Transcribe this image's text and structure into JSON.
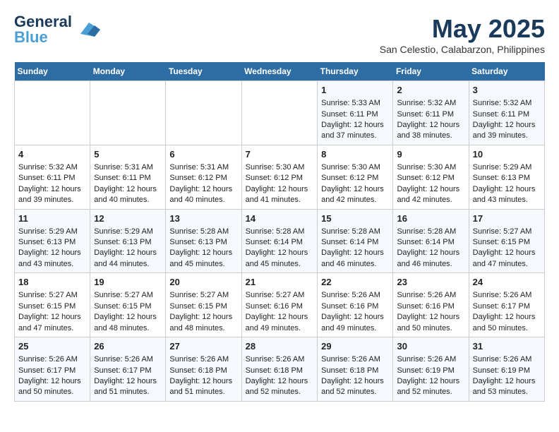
{
  "header": {
    "logo_line1": "General",
    "logo_line2": "Blue",
    "month_year": "May 2025",
    "location": "San Celestio, Calabarzon, Philippines"
  },
  "days_of_week": [
    "Sunday",
    "Monday",
    "Tuesday",
    "Wednesday",
    "Thursday",
    "Friday",
    "Saturday"
  ],
  "weeks": [
    [
      {
        "day": "",
        "sunrise": "",
        "sunset": "",
        "daylight": ""
      },
      {
        "day": "",
        "sunrise": "",
        "sunset": "",
        "daylight": ""
      },
      {
        "day": "",
        "sunrise": "",
        "sunset": "",
        "daylight": ""
      },
      {
        "day": "",
        "sunrise": "",
        "sunset": "",
        "daylight": ""
      },
      {
        "day": "1",
        "sunrise": "5:33 AM",
        "sunset": "6:11 PM",
        "daylight": "12 hours and 37 minutes."
      },
      {
        "day": "2",
        "sunrise": "5:32 AM",
        "sunset": "6:11 PM",
        "daylight": "12 hours and 38 minutes."
      },
      {
        "day": "3",
        "sunrise": "5:32 AM",
        "sunset": "6:11 PM",
        "daylight": "12 hours and 39 minutes."
      }
    ],
    [
      {
        "day": "4",
        "sunrise": "5:32 AM",
        "sunset": "6:11 PM",
        "daylight": "12 hours and 39 minutes."
      },
      {
        "day": "5",
        "sunrise": "5:31 AM",
        "sunset": "6:11 PM",
        "daylight": "12 hours and 40 minutes."
      },
      {
        "day": "6",
        "sunrise": "5:31 AM",
        "sunset": "6:12 PM",
        "daylight": "12 hours and 40 minutes."
      },
      {
        "day": "7",
        "sunrise": "5:30 AM",
        "sunset": "6:12 PM",
        "daylight": "12 hours and 41 minutes."
      },
      {
        "day": "8",
        "sunrise": "5:30 AM",
        "sunset": "6:12 PM",
        "daylight": "12 hours and 42 minutes."
      },
      {
        "day": "9",
        "sunrise": "5:30 AM",
        "sunset": "6:12 PM",
        "daylight": "12 hours and 42 minutes."
      },
      {
        "day": "10",
        "sunrise": "5:29 AM",
        "sunset": "6:13 PM",
        "daylight": "12 hours and 43 minutes."
      }
    ],
    [
      {
        "day": "11",
        "sunrise": "5:29 AM",
        "sunset": "6:13 PM",
        "daylight": "12 hours and 43 minutes."
      },
      {
        "day": "12",
        "sunrise": "5:29 AM",
        "sunset": "6:13 PM",
        "daylight": "12 hours and 44 minutes."
      },
      {
        "day": "13",
        "sunrise": "5:28 AM",
        "sunset": "6:13 PM",
        "daylight": "12 hours and 45 minutes."
      },
      {
        "day": "14",
        "sunrise": "5:28 AM",
        "sunset": "6:14 PM",
        "daylight": "12 hours and 45 minutes."
      },
      {
        "day": "15",
        "sunrise": "5:28 AM",
        "sunset": "6:14 PM",
        "daylight": "12 hours and 46 minutes."
      },
      {
        "day": "16",
        "sunrise": "5:28 AM",
        "sunset": "6:14 PM",
        "daylight": "12 hours and 46 minutes."
      },
      {
        "day": "17",
        "sunrise": "5:27 AM",
        "sunset": "6:15 PM",
        "daylight": "12 hours and 47 minutes."
      }
    ],
    [
      {
        "day": "18",
        "sunrise": "5:27 AM",
        "sunset": "6:15 PM",
        "daylight": "12 hours and 47 minutes."
      },
      {
        "day": "19",
        "sunrise": "5:27 AM",
        "sunset": "6:15 PM",
        "daylight": "12 hours and 48 minutes."
      },
      {
        "day": "20",
        "sunrise": "5:27 AM",
        "sunset": "6:15 PM",
        "daylight": "12 hours and 48 minutes."
      },
      {
        "day": "21",
        "sunrise": "5:27 AM",
        "sunset": "6:16 PM",
        "daylight": "12 hours and 49 minutes."
      },
      {
        "day": "22",
        "sunrise": "5:26 AM",
        "sunset": "6:16 PM",
        "daylight": "12 hours and 49 minutes."
      },
      {
        "day": "23",
        "sunrise": "5:26 AM",
        "sunset": "6:16 PM",
        "daylight": "12 hours and 50 minutes."
      },
      {
        "day": "24",
        "sunrise": "5:26 AM",
        "sunset": "6:17 PM",
        "daylight": "12 hours and 50 minutes."
      }
    ],
    [
      {
        "day": "25",
        "sunrise": "5:26 AM",
        "sunset": "6:17 PM",
        "daylight": "12 hours and 50 minutes."
      },
      {
        "day": "26",
        "sunrise": "5:26 AM",
        "sunset": "6:17 PM",
        "daylight": "12 hours and 51 minutes."
      },
      {
        "day": "27",
        "sunrise": "5:26 AM",
        "sunset": "6:18 PM",
        "daylight": "12 hours and 51 minutes."
      },
      {
        "day": "28",
        "sunrise": "5:26 AM",
        "sunset": "6:18 PM",
        "daylight": "12 hours and 52 minutes."
      },
      {
        "day": "29",
        "sunrise": "5:26 AM",
        "sunset": "6:18 PM",
        "daylight": "12 hours and 52 minutes."
      },
      {
        "day": "30",
        "sunrise": "5:26 AM",
        "sunset": "6:19 PM",
        "daylight": "12 hours and 52 minutes."
      },
      {
        "day": "31",
        "sunrise": "5:26 AM",
        "sunset": "6:19 PM",
        "daylight": "12 hours and 53 minutes."
      }
    ]
  ]
}
